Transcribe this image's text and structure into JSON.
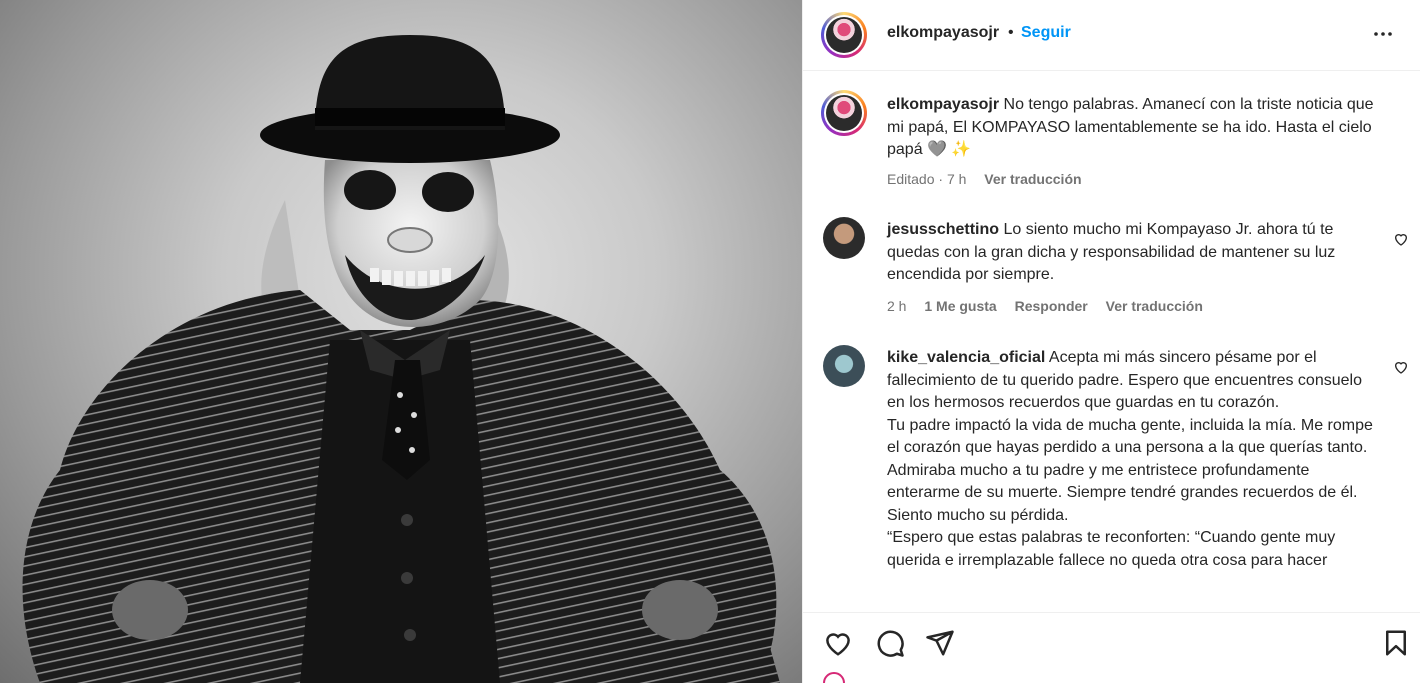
{
  "post": {
    "username": "elkompayasojr",
    "separator": "•",
    "follow_label": "Seguir",
    "more_icon": "more-horizontal-icon",
    "caption": {
      "username": "elkompayasojr",
      "text": "No tengo palabras. Amanecí con la triste noticia que mi papá, El KOMPAYASO lamentablemente se ha ido. Hasta el cielo papá 🩶 ✨",
      "edited": "Editado",
      "time": "7 h",
      "translate": "Ver traducción"
    }
  },
  "comments": [
    {
      "username": "jesusschettino",
      "text": "Lo siento mucho mi Kompayaso Jr. ahora tú te quedas con la gran dicha y responsabilidad de mantener su luz encendida por siempre.",
      "time": "2 h",
      "likes": "1 Me gusta",
      "reply": "Responder",
      "translate": "Ver traducción"
    },
    {
      "username": "kike_valencia_oficial",
      "paragraphs": [
        "Acepta mi más sincero pésame por el fallecimiento de tu querido padre. Espero que encuentres consuelo en los hermosos recuerdos que guardas en tu corazón.",
        "Tu padre impactó la vida de mucha gente, incluida la mía. Me rompe el corazón que hayas perdido a una persona a la que querías tanto.",
        "Admiraba mucho a tu padre y me entristece profundamente enterarme de su muerte. Siempre tendré grandes recuerdos de él. Siento mucho su pérdida.",
        "“Espero que estas palabras te reconforten: “Cuando gente muy querida e irremplazable fallece no queda otra cosa para hacer"
      ]
    }
  ],
  "actions": {
    "like_icon": "heart-icon",
    "comment_icon": "comment-icon",
    "share_icon": "send-icon",
    "save_icon": "bookmark-icon"
  },
  "colors": {
    "accent": "#0095f6",
    "text": "#262626",
    "muted": "#737373",
    "border": "#efefef"
  }
}
